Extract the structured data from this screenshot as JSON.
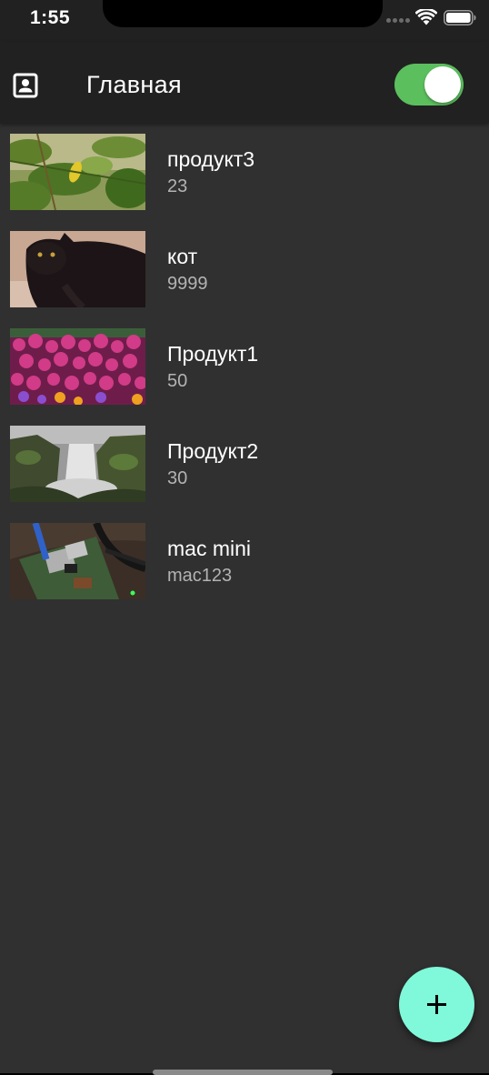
{
  "status_bar": {
    "time": "1:55",
    "signal_icon": "cellular-signal-icon",
    "wifi_icon": "wifi-icon",
    "battery_icon": "battery-icon"
  },
  "app_bar": {
    "title": "Главная",
    "leading_icon": "contact-card-icon",
    "toggle": {
      "on": true,
      "color": "#5cbf5e"
    },
    "background": "#212121"
  },
  "products": [
    {
      "name": "продукт3",
      "subtitle": "23",
      "image": "lemon-tree-photo"
    },
    {
      "name": "кот",
      "subtitle": "9999",
      "image": "black-cat-photo"
    },
    {
      "name": "Продукт1",
      "subtitle": "50",
      "image": "pink-flowers-photo"
    },
    {
      "name": "Продукт2",
      "subtitle": "30",
      "image": "waterfall-photo"
    },
    {
      "name": "mac mini",
      "subtitle": "mac123",
      "image": "circuit-board-photo"
    }
  ],
  "fab": {
    "icon": "plus-icon",
    "color": "#7ff9d9"
  },
  "theme": {
    "background": "#303030",
    "subtitle_color": "#b3b3b3"
  }
}
